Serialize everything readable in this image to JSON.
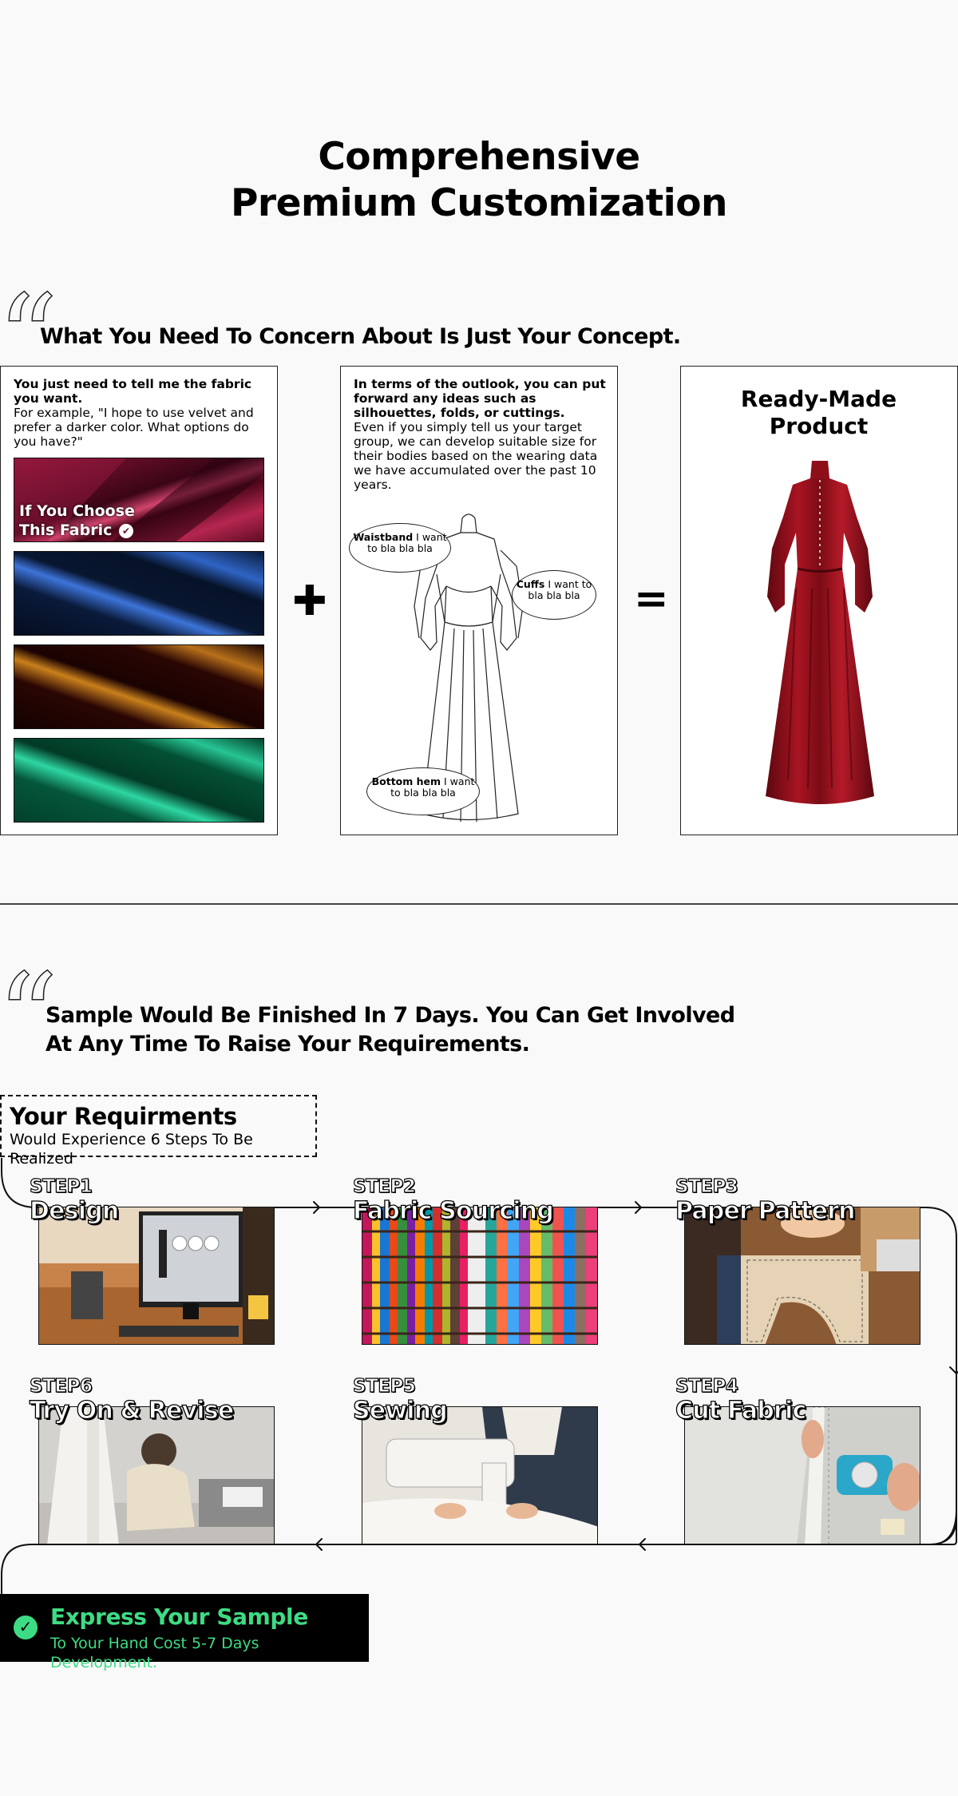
{
  "header": {
    "title_line1": "Comprehensive",
    "title_line2": "Premium Customization"
  },
  "concept": {
    "heading": "What You Need To Concern About Is Just Your Concept.",
    "fabric_panel": {
      "intro_bold": "You just need to tell me the fabric you want.",
      "intro_text": "For example, \"I hope to use velvet and prefer a darker color. What options do you have?\"",
      "selected_label_line1": "If You  Choose",
      "selected_label_line2": "This Fabric",
      "swatches": [
        {
          "name": "burgundy velvet",
          "base": "#5a0a22",
          "shine": "#d2446e"
        },
        {
          "name": "navy velvet",
          "base": "#061228",
          "shine": "#3d74d8"
        },
        {
          "name": "brown velvet",
          "base": "#1a0302",
          "shine": "#c9801c"
        },
        {
          "name": "emerald velvet",
          "base": "#02402a",
          "shine": "#2ed6a2"
        }
      ]
    },
    "plus_symbol": "✚",
    "design_panel": {
      "intro_bold": "In terms of the outlook, you can put forward any ideas such as silhouettes, folds, or cuttings.",
      "intro_text": "Even if you simply tell us your target group, we can develop suitable size for their bodies based on the wearing data we have accumulated over the past 10 years.",
      "bubbles": [
        {
          "bold": "Waistband",
          "text": " I want to bla bla bla"
        },
        {
          "bold": "Cuffs",
          "text": " I want to bla bla bla"
        },
        {
          "bold": "Bottom hem",
          "text": " I want to bla bla bla"
        }
      ]
    },
    "equals_symbol": "=",
    "product_panel": {
      "title_line1": "Ready-Made",
      "title_line2": "Product",
      "dress_color": "#8e0f1a"
    }
  },
  "process": {
    "heading_line1": "Sample Would Be Finished In 7 Days. You Can Get Involved",
    "heading_line2": "At Any Time To Raise Your Requirements.",
    "requirements": {
      "title": "Your Requirments",
      "subtitle": "Would Experience 6 Steps To Be Realized"
    },
    "steps": [
      {
        "num": "STEP1",
        "name": "Design"
      },
      {
        "num": "STEP2",
        "name": "Fabric Sourcing"
      },
      {
        "num": "STEP3",
        "name": "Paper Pattern"
      },
      {
        "num": "STEP4",
        "name": "Cut Fabric"
      },
      {
        "num": "STEP5",
        "name": "Sewing"
      },
      {
        "num": "STEP6",
        "name": "Try On & Revise"
      }
    ],
    "express": {
      "title": "Express Your Sample",
      "subtitle": "To Your Hand Cost 5-7 Days Development.",
      "accent": "#3ddc84"
    }
  }
}
